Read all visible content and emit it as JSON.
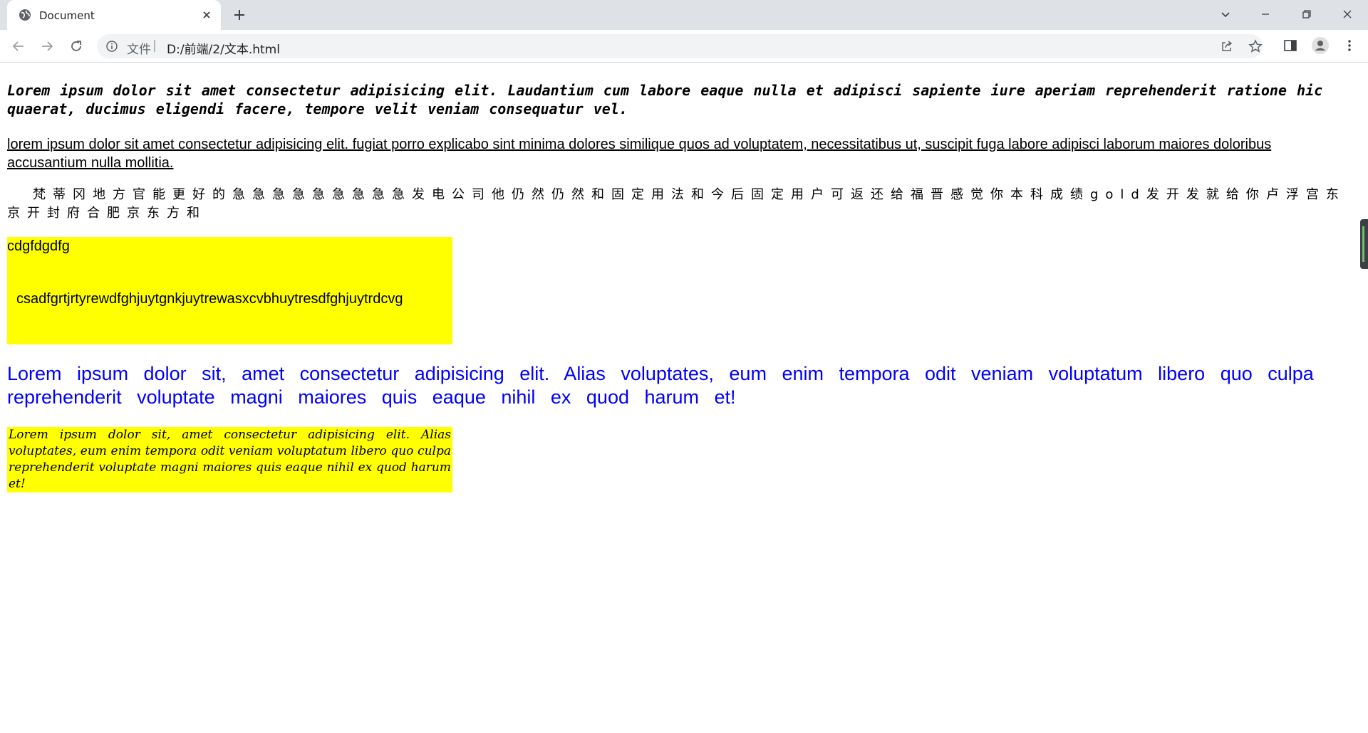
{
  "browser": {
    "tab": {
      "title": "Document"
    },
    "address": {
      "scheme_label": "文件",
      "separator": "|",
      "url": "D:/前端/2/文本.html"
    }
  },
  "page": {
    "p1": "Lorem ipsum dolor sit amet consectetur adipisicing elit. Laudantium cum labore eaque nulla et adipisci sapiente iure aperiam reprehenderit ratione hic quaerat, ducimus eligendi facere, tempore velit veniam consequatur vel.",
    "p2": "lorem ipsum dolor sit amet consectetur adipisicing elit. fugiat porro explicabo sint minima dolores similique quos ad voluptatem, necessitatibus ut, suscipit fuga labore adipisci laborum maiores doloribus accusantium nulla mollitia.",
    "p3": "梵蒂冈地方官能更好的急急急急急急急急急发电公司他仍然仍然和固定用法和今后固定用户可返还给福晋感觉你本科成绩gold发开发就给你卢浮宫东京开封府合肥京东方和",
    "box1": {
      "line1": "cdgfdgdfg",
      "line2": "csadfgrtjrtyrewdfghjuytgnkjuytrewasxcvbhuytresdfghjuytrdcvg"
    },
    "p4": "Lorem ipsum dolor sit, amet consectetur adipisicing elit. Alias voluptates, eum enim tempora odit veniam voluptatum libero quo culpa reprehenderit voluptate magni maiores quis eaque nihil ex quod harum et!",
    "box2": "Lorem ipsum dolor sit, amet consectetur adipisicing elit. Alias voluptates, eum enim tempora odit veniam voluptatum libero quo culpa reprehenderit voluptate magni maiores quis eaque nihil ex quod harum et!"
  },
  "colors": {
    "highlight": "#ffff00",
    "blue_text": "#0000ff",
    "tabstrip": "#dee1e6"
  },
  "icons": [
    "globe-icon",
    "close-icon",
    "plus-icon",
    "chevron-down-icon",
    "minimize-icon",
    "restore-icon",
    "window-close-icon",
    "back-icon",
    "forward-icon",
    "reload-icon",
    "info-icon",
    "share-icon",
    "star-icon",
    "side-panel-icon",
    "profile-icon",
    "menu-icon"
  ]
}
